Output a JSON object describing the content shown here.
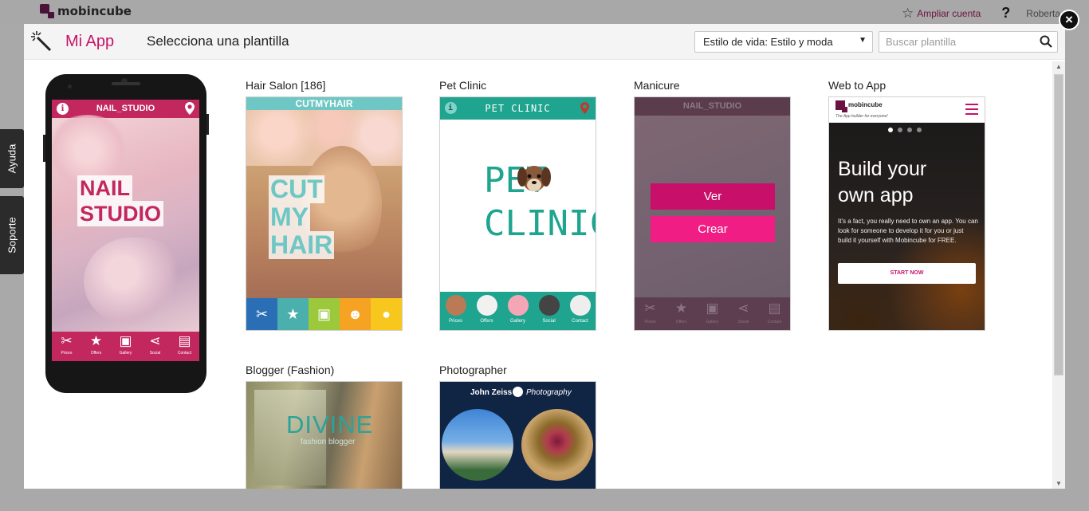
{
  "topbar": {
    "brand": "mobincube",
    "upgrade_label": "Ampliar cuenta",
    "help_label": "?",
    "user_name": "Roberta"
  },
  "side_tabs": [
    "Ayuda",
    "Soporte"
  ],
  "modal": {
    "app_title": "Mi App",
    "subtitle": "Selecciona una plantilla",
    "category_filter": "Estilo de vida: Estilo y moda",
    "search_placeholder": "Buscar plantilla",
    "close_label": "×"
  },
  "phone_preview": {
    "header": "NAIL_STUDIO",
    "logo_lines": [
      "NAIL",
      "STUDIO"
    ],
    "footer_items": [
      "Prices",
      "Offers",
      "Gallery",
      "Social",
      "Contact"
    ]
  },
  "templates": [
    {
      "title": "Hair Salon [186]",
      "header": "CUTMYHAIR",
      "logo_lines": [
        "CUT",
        "MY",
        "HAIR"
      ]
    },
    {
      "title": "Pet Clinic",
      "header": "PET CLINIC",
      "logo_lines": [
        "PET",
        "CLINIC"
      ],
      "footer_items": [
        "Prices",
        "Offers",
        "Gallery",
        "Social",
        "Contact"
      ]
    },
    {
      "title": "Manicure",
      "header": "NAIL_STUDIO",
      "view_label": "Ver",
      "create_label": "Crear",
      "footer_items": [
        "Prices",
        "Offers",
        "Gallery",
        "Social",
        "Contact"
      ]
    },
    {
      "title": "Web to App",
      "brand": "mobincube",
      "tagline": "The App builder for everyone!",
      "headline_lines": [
        "Build your",
        "own app"
      ],
      "body": "It's a fact, you really need to own an app. You can look for someone to develop it for you or just build it yourself with Mobincube for FREE.",
      "cta": "START NOW"
    },
    {
      "title": "Blogger (Fashion)",
      "logo": "DIVINE",
      "tagline": "fashion blogger"
    },
    {
      "title": "Photographer",
      "name": "John Zeiss",
      "tagline": "Photography"
    }
  ],
  "colors": {
    "accent": "#c8126a",
    "button_view": "#c8106a",
    "button_create": "#f01d85",
    "nail_studio": "#c2275e",
    "hair_salon": "#6ec7c4",
    "pet_clinic": "#1fa48f"
  }
}
